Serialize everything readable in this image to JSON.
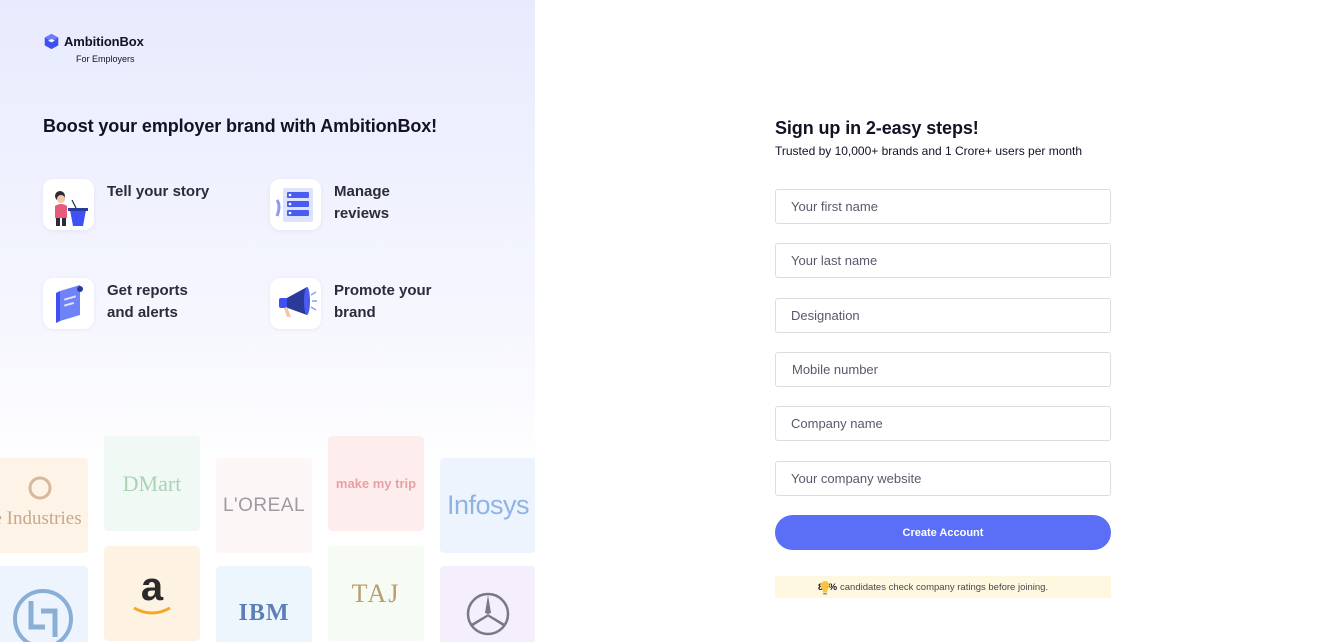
{
  "logo": {
    "name": "AmbitionBox",
    "sub": "For Employers",
    "icon": "ambitionbox-logo-icon"
  },
  "headline": "Boost your employer brand with AmbitionBox!",
  "features": [
    {
      "label": "Tell your story",
      "icon": "speaker-at-podium-icon"
    },
    {
      "label": "Manage reviews",
      "icon": "review-list-icon"
    },
    {
      "label": "Get reports and alerts",
      "icon": "report-document-icon"
    },
    {
      "label": "Promote your brand",
      "icon": "megaphone-icon"
    }
  ],
  "brands": [
    "Reliance Industries Limited",
    "DMart",
    "L'OREAL",
    "make my trip",
    "Infosys",
    "L&T",
    "amazon",
    "IBM",
    "TAJ",
    "Mercedes-Benz"
  ],
  "signup": {
    "title": "Sign up in 2-easy steps!",
    "subtitle": "Trusted by 10,000+ brands and 1 Crore+ users per month",
    "fields": {
      "first_name": "Your first name",
      "last_name": "Your last name",
      "designation": "Designation",
      "mobile": "Mobile number",
      "company": "Company name",
      "website": "Your company website"
    },
    "button": "Create Account",
    "tip_bold": "80%",
    "tip_text": "candidates check company ratings before joining."
  },
  "colors": {
    "accent": "#5a6ff5",
    "tip_bg": "#fff8e0"
  }
}
